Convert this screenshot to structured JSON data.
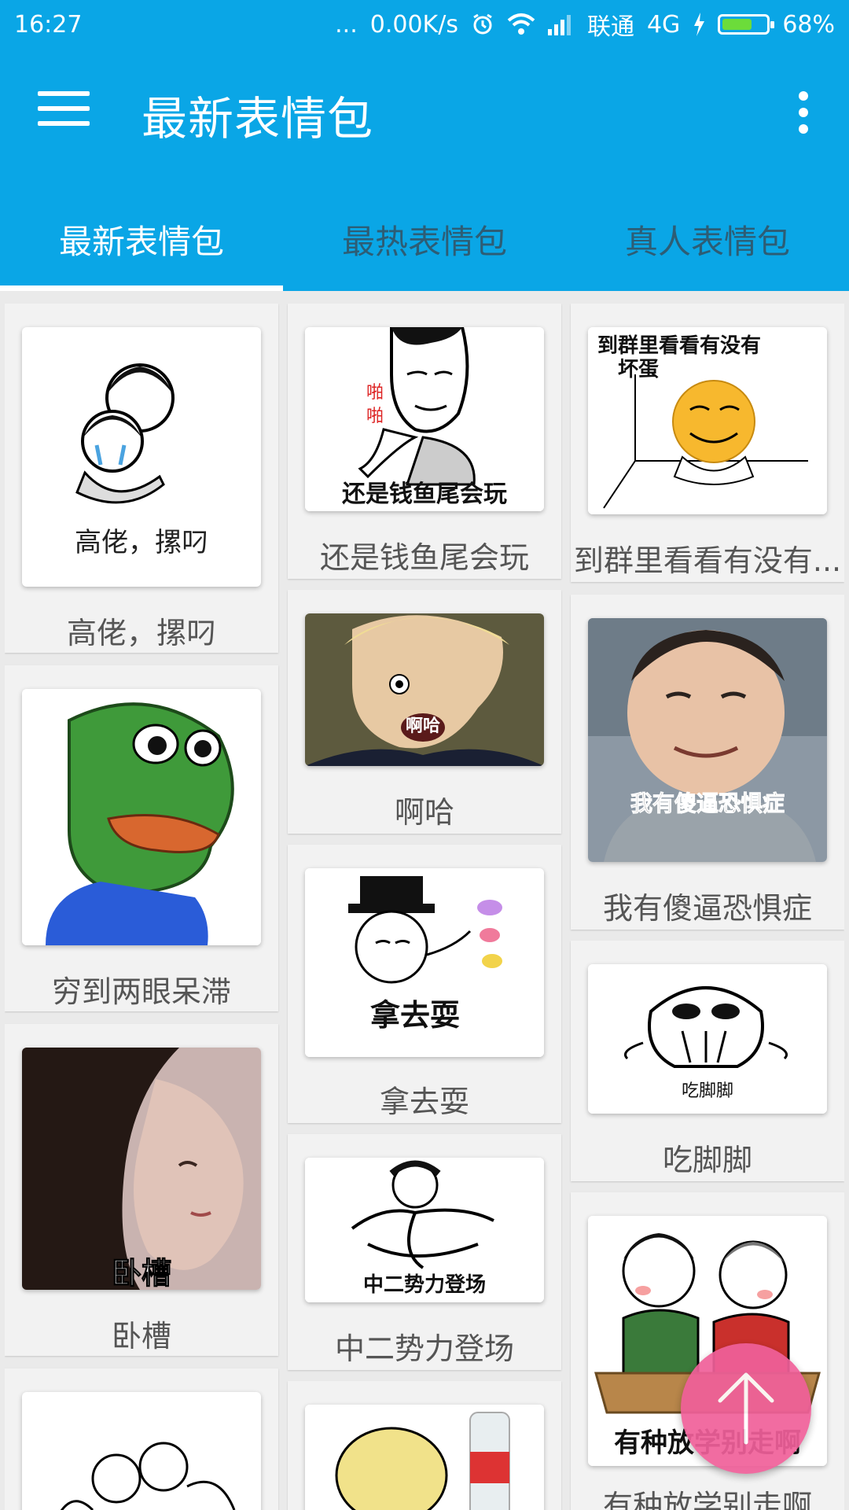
{
  "status_bar": {
    "time": "16:27",
    "dots": "...",
    "speed": "0.00K/s",
    "carrier": "联通",
    "network": "4G",
    "battery_level": 0.68,
    "battery_text": "68%",
    "icons": [
      "alarm-icon",
      "wifi-icon",
      "signal-icon",
      "charging-icon",
      "battery-icon"
    ]
  },
  "toolbar": {
    "title": "最新表情包",
    "menu_icon": "hamburger-menu-icon",
    "more_icon": "more-vert-icon"
  },
  "tabs": [
    {
      "label": "最新表情包",
      "active": true
    },
    {
      "label": "最热表情包",
      "active": false
    },
    {
      "label": "真人表情包",
      "active": false
    }
  ],
  "items": {
    "col1": [
      {
        "caption": "高佬，摞叼",
        "image_text": "高佬，摞叼"
      },
      {
        "caption": "穷到两眼呆滞",
        "image_text": ""
      },
      {
        "caption": "卧槽",
        "image_text": "卧槽"
      },
      {
        "caption": "",
        "image_text": ""
      }
    ],
    "col2": [
      {
        "caption": "还是钱鱼尾会玩",
        "image_text": "还是钱鱼尾会玩",
        "extra_text": "啪啪"
      },
      {
        "caption": "啊哈",
        "image_text": "啊哈"
      },
      {
        "caption": "拿去耍",
        "image_text": "拿去耍"
      },
      {
        "caption": "中二势力登场",
        "image_text": "中二势力登场"
      },
      {
        "caption": "",
        "image_text": ""
      }
    ],
    "col3": [
      {
        "caption": "到群里看看有没有...",
        "image_text_line1": "到群里看看有没有",
        "image_text_line2": "坏蛋"
      },
      {
        "caption": "我有傻逼恐惧症",
        "image_text": "我有傻逼恐惧症"
      },
      {
        "caption": "吃脚脚",
        "image_text": "吃脚脚"
      },
      {
        "caption": "有种放学别走啊",
        "image_text": "有种放学别走啊"
      }
    ]
  },
  "fab": {
    "icon": "arrow-up-icon",
    "color": "#f0609a"
  },
  "colors": {
    "primary": "#0aa6e6",
    "inactive_tab": "#2d5d75",
    "background": "#eaeaea"
  }
}
